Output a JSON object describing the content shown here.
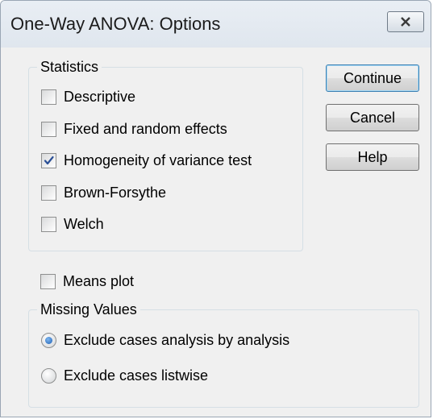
{
  "window": {
    "title": "One-Way ANOVA: Options"
  },
  "statistics": {
    "label": "Statistics",
    "items": [
      {
        "label": "Descriptive",
        "checked": false
      },
      {
        "label": "Fixed and random effects",
        "checked": false
      },
      {
        "label": "Homogeneity of variance test",
        "checked": true
      },
      {
        "label": "Brown-Forsythe",
        "checked": false
      },
      {
        "label": "Welch",
        "checked": false
      }
    ]
  },
  "means_plot": {
    "label": "Means plot",
    "checked": false
  },
  "missing_values": {
    "label": "Missing Values",
    "options": [
      {
        "label": "Exclude cases analysis by analysis",
        "selected": true
      },
      {
        "label": "Exclude cases listwise",
        "selected": false
      }
    ]
  },
  "buttons": {
    "continue": "Continue",
    "cancel": "Cancel",
    "help": "Help"
  },
  "icons": {
    "close": "close-icon",
    "check": "checkmark-icon"
  },
  "colors": {
    "accent": "#1e5fb3",
    "check": "#2a4f96"
  }
}
